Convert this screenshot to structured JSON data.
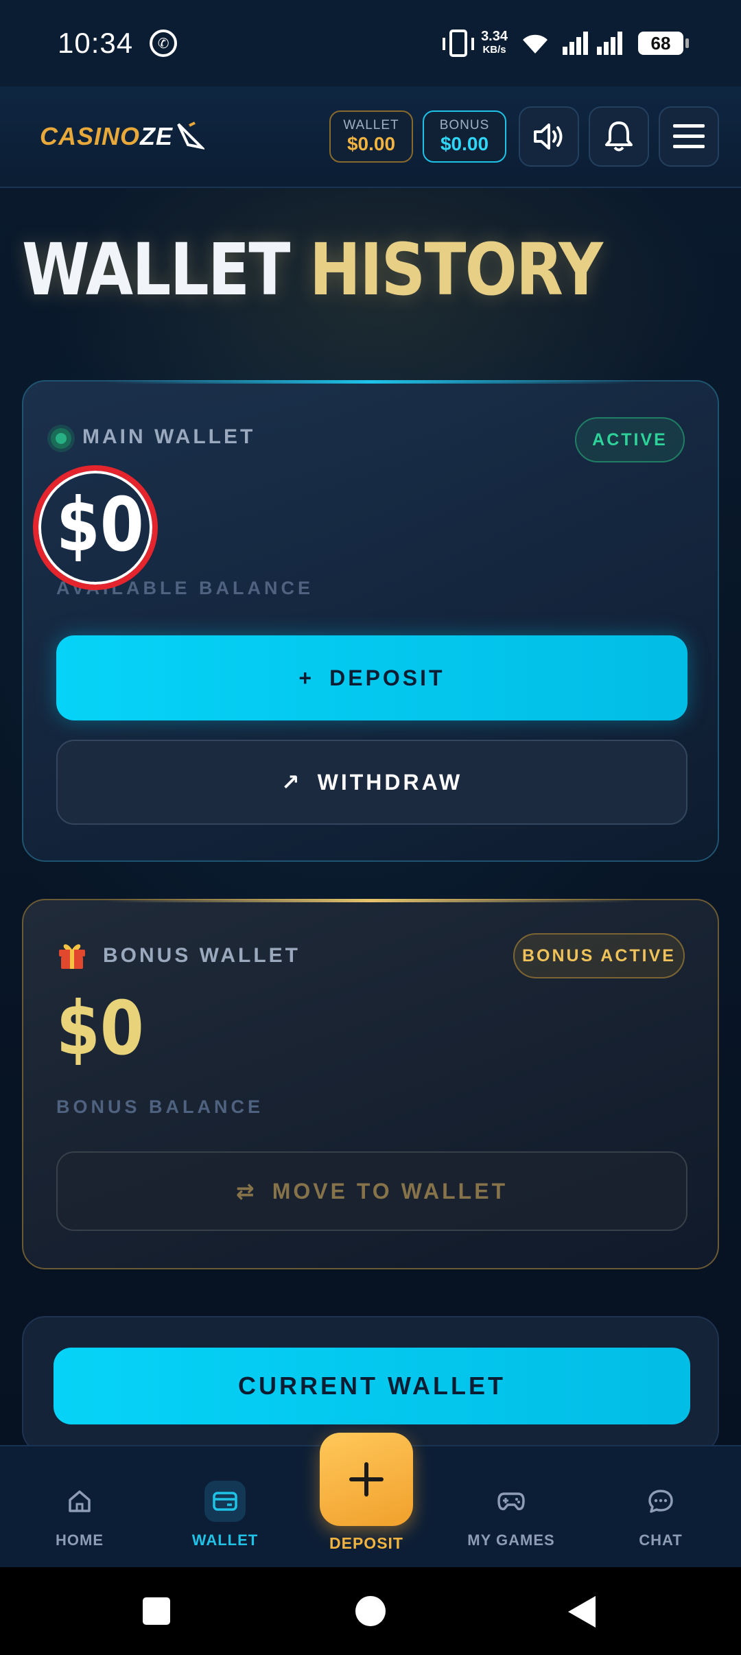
{
  "status": {
    "time": "10:34",
    "speed_value": "3.34",
    "speed_unit": "KB/s",
    "battery": "68"
  },
  "header": {
    "logo_a": "CASINO",
    "logo_b": "ZE",
    "wallet_label": "WALLET",
    "wallet_value": "$0.00",
    "bonus_label": "BONUS",
    "bonus_value": "$0.00"
  },
  "page": {
    "title_a": "WALLET",
    "title_b": "HISTORY"
  },
  "main_wallet": {
    "label": "MAIN WALLET",
    "status": "ACTIVE",
    "balance": "$0",
    "balance_caption": "AVAILABLE BALANCE",
    "deposit_icon": "+",
    "deposit_label": "DEPOSIT",
    "withdraw_icon": "↗",
    "withdraw_label": "WITHDRAW"
  },
  "bonus_wallet": {
    "label": "BONUS WALLET",
    "status": "BONUS ACTIVE",
    "balance": "$0",
    "balance_caption": "BONUS BALANCE",
    "move_icon": "⇄",
    "move_label": "MOVE TO WALLET"
  },
  "current_wallet": {
    "label": "CURRENT WALLET"
  },
  "nav": {
    "home": "HOME",
    "wallet": "WALLET",
    "deposit": "DEPOSIT",
    "games": "MY GAMES",
    "chat": "CHAT"
  },
  "colors": {
    "accent_cyan": "#06d3f7",
    "accent_gold": "#f1b441",
    "active_green": "#2ed39a"
  },
  "icons": [
    "whatsapp-icon",
    "vibrate-icon",
    "wifi-icon",
    "signal-icon",
    "sound-icon",
    "bell-icon",
    "menu-icon",
    "gift-icon",
    "home-icon",
    "wallet-icon",
    "plus-icon",
    "gamepad-icon",
    "chat-icon"
  ]
}
